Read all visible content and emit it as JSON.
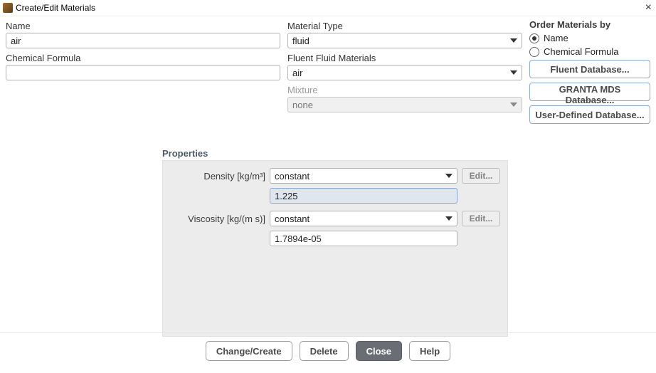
{
  "window": {
    "title": "Create/Edit Materials"
  },
  "left": {
    "name_label": "Name",
    "name_value": "air",
    "formula_label": "Chemical Formula",
    "formula_value": ""
  },
  "mid": {
    "material_type_label": "Material Type",
    "material_type_value": "fluid",
    "fluent_materials_label": "Fluent Fluid Materials",
    "fluent_materials_value": "air",
    "mixture_label": "Mixture",
    "mixture_value": "none"
  },
  "right": {
    "order_heading": "Order Materials by",
    "order_name": "Name",
    "order_formula": "Chemical Formula",
    "btn_fluent_db": "Fluent Database...",
    "btn_granta_db": "GRANTA MDS Database...",
    "btn_user_db": "User-Defined Database..."
  },
  "properties": {
    "heading": "Properties",
    "density_label": "Density [kg/m³]",
    "density_method": "constant",
    "density_value": "1.225",
    "viscosity_label": "Viscosity [kg/(m s)]",
    "viscosity_method": "constant",
    "viscosity_value": "1.7894e-05",
    "edit_label": "Edit..."
  },
  "footer": {
    "change_create": "Change/Create",
    "delete": "Delete",
    "close": "Close",
    "help": "Help"
  }
}
